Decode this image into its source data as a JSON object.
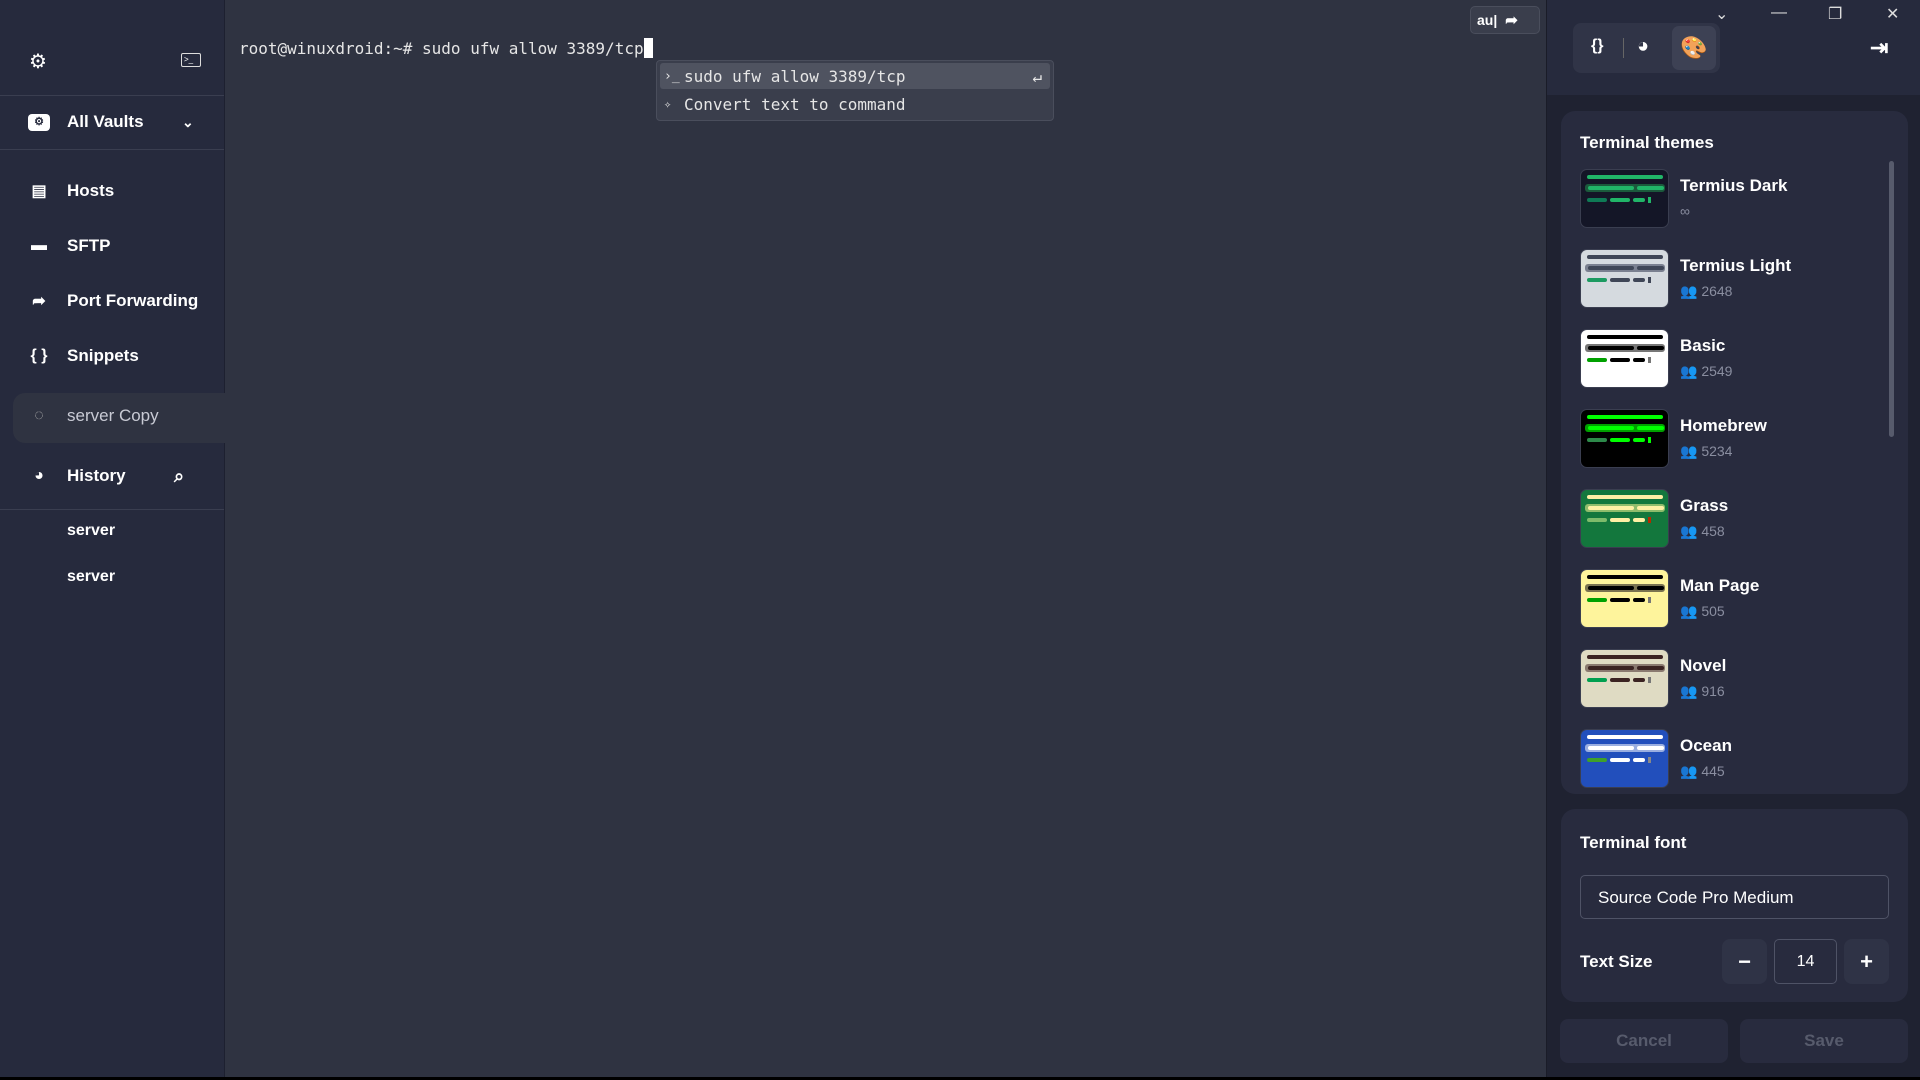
{
  "sidebar": {
    "vault": "All Vaults",
    "items": [
      {
        "label": "Hosts",
        "icon": "hosts-icon"
      },
      {
        "label": "SFTP",
        "icon": "folder-icon"
      },
      {
        "label": "Port Forwarding",
        "icon": "port-forwarding-icon"
      },
      {
        "label": "Snippets",
        "icon": "snippets-icon"
      }
    ],
    "active_session": "server Copy",
    "history_label": "History",
    "history": [
      "server",
      "server"
    ]
  },
  "terminal": {
    "prompt": "root@winuxdroid:~#",
    "command": "sudo ufw allow 3389/tcp",
    "autocomplete": [
      {
        "icon": "terminal-prompt-icon",
        "label": "sudo ufw allow 3389/tcp",
        "hint": "↵"
      },
      {
        "icon": "magic-wand-icon",
        "label": "Convert text to command"
      }
    ],
    "ai_input": "au|"
  },
  "panel": {
    "themes_title": "Terminal themes",
    "themes": [
      {
        "name": "Termius Dark",
        "count": "∞",
        "colors": {
          "bg": "#141627",
          "fg": "#21b568",
          "band": "#1b5a3c",
          "prompt": "#0f7a55",
          "cursor": "#21b568"
        }
      },
      {
        "name": "Termius Light",
        "count": "2648",
        "colors": {
          "bg": "#d5dadf",
          "fg": "#3f4657",
          "band": "#7a8090",
          "prompt": "#1c9a61",
          "cursor": "#3f4657"
        }
      },
      {
        "name": "Basic",
        "count": "2549",
        "colors": {
          "bg": "#ffffff",
          "fg": "#000000",
          "band": "#777777",
          "prompt": "#00a000",
          "cursor": "#777777"
        }
      },
      {
        "name": "Homebrew",
        "count": "5234",
        "colors": {
          "bg": "#000000",
          "fg": "#00ff00",
          "band": "#00a000",
          "prompt": "#2d8a4a",
          "cursor": "#00ff00"
        }
      },
      {
        "name": "Grass",
        "count": "458",
        "colors": {
          "bg": "#13773d",
          "fg": "#fff0a5",
          "band": "#8fbc6c",
          "prompt": "#7dbb6b",
          "cursor": "#b52a00"
        }
      },
      {
        "name": "Man Page",
        "count": "505",
        "colors": {
          "bg": "#fef49c",
          "fg": "#000000",
          "band": "#7a7350",
          "prompt": "#00a000",
          "cursor": "#777777"
        }
      },
      {
        "name": "Novel",
        "count": "916",
        "colors": {
          "bg": "#dfdbc3",
          "fg": "#3b2322",
          "band": "#8a7a70",
          "prompt": "#009f4f",
          "cursor": "#777777"
        }
      },
      {
        "name": "Ocean",
        "count": "445",
        "colors": {
          "bg": "#224fbc",
          "fg": "#ffffff",
          "band": "#9aaee0",
          "prompt": "#3fa02a",
          "cursor": "#888888"
        }
      }
    ],
    "font_title": "Terminal font",
    "font_value": "Source Code Pro Medium",
    "text_size_label": "Text Size",
    "text_size": "14",
    "minus": "−",
    "plus": "+",
    "cancel": "Cancel",
    "save": "Save"
  }
}
